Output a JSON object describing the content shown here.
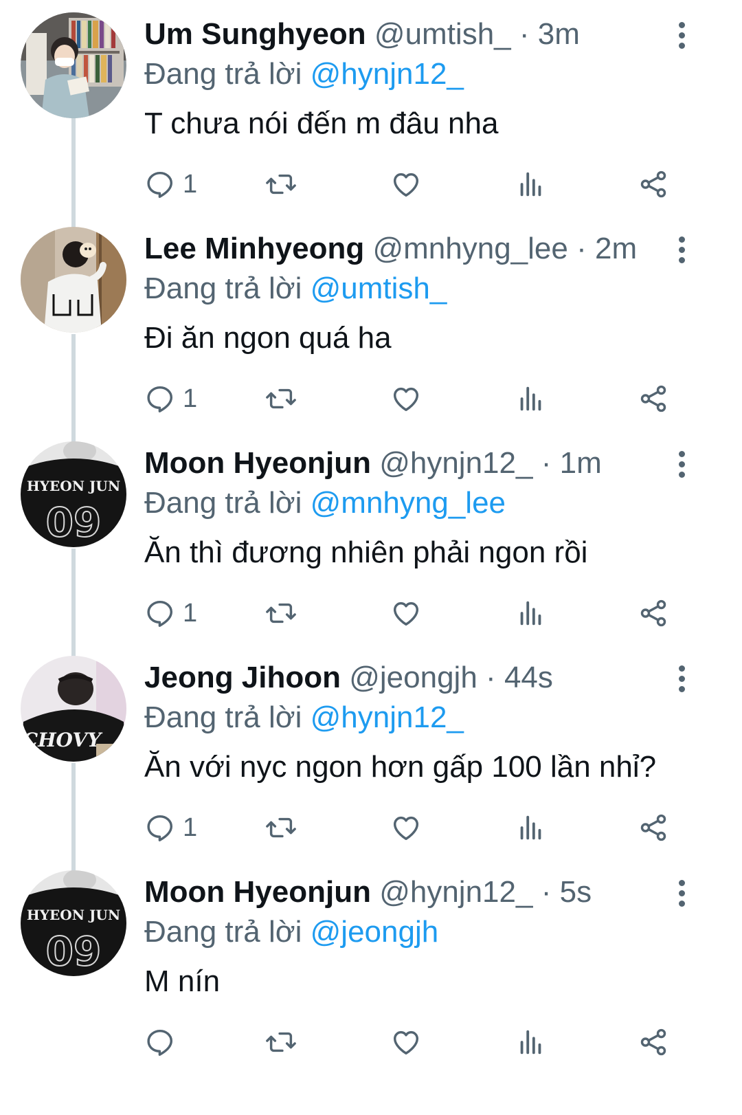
{
  "replying_prefix": "Đang trả lời",
  "tweets": [
    {
      "name": "Um Sunghyeon",
      "handle": "@umtish_",
      "sep": "·",
      "time": "3m",
      "reply_to": "@hynjn12_",
      "text": "T chưa nói đến m đâu nha",
      "reply_count": "1",
      "avatar": "photo-reading-books"
    },
    {
      "name": "Lee Minhyeong",
      "handle": "@mnhyng_lee",
      "sep": "·",
      "time": "2m",
      "reply_to": "@umtish_",
      "text": "Đi ăn ngon quá ha",
      "reply_count": "1",
      "avatar": "photo-with-puppy"
    },
    {
      "name": "Moon Hyeonjun",
      "handle": "@hynjn12_",
      "sep": "·",
      "time": "1m",
      "reply_to": "@mnhyng_lee",
      "text": "Ăn thì đương nhiên phải ngon rồi",
      "reply_count": "1",
      "avatar": "photo-jersey-09"
    },
    {
      "name": "Jeong Jihoon",
      "handle": "@jeongjh",
      "sep": "·",
      "time": "44s",
      "reply_to": "@hynjn12_",
      "text": "Ăn với nyc ngon hơn gấp 100 lần nhỉ?",
      "reply_count": "1",
      "avatar": "photo-chovy-jersey"
    },
    {
      "name": "Moon Hyeonjun",
      "handle": "@hynjn12_",
      "sep": "·",
      "time": "5s",
      "reply_to": "@jeongjh",
      "text": "M nín",
      "reply_count": "",
      "avatar": "photo-jersey-09"
    }
  ],
  "avatar_text": {
    "jersey_name": "HYEON JUN",
    "jersey_number": "09",
    "chovy": "CHOVY"
  },
  "colors": {
    "text": "#0f1419",
    "secondary": "#536471",
    "link": "#1d9bf0",
    "thread_line": "#cfd9de"
  },
  "icons": [
    "reply-icon",
    "retweet-icon",
    "like-icon",
    "stats-icon",
    "share-icon",
    "more-icon"
  ]
}
